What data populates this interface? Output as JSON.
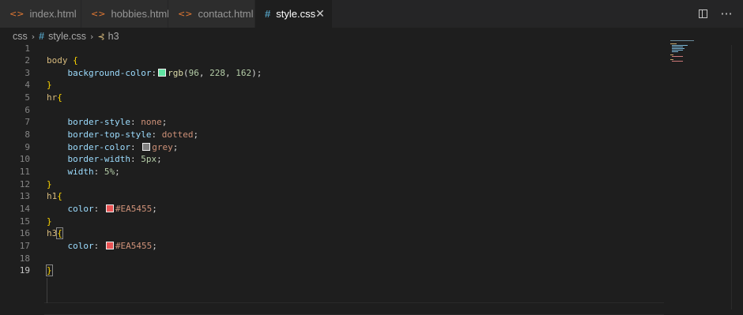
{
  "tabs": [
    {
      "label": "index.html",
      "icon": "html-icon",
      "active": false
    },
    {
      "label": "hobbies.html",
      "icon": "html-icon",
      "active": false
    },
    {
      "label": "contact.html",
      "icon": "html-icon",
      "active": false
    },
    {
      "label": "style.css",
      "icon": "css-hash-icon",
      "active": true
    }
  ],
  "tab_close_glyph": "✕",
  "breadcrumb": {
    "folder": "css",
    "file": "style.css",
    "symbol": "h3"
  },
  "editor": {
    "current_line": 19,
    "lines": [
      {
        "n": "1"
      },
      {
        "n": "2",
        "selector": "body ",
        "open": "{"
      },
      {
        "n": "3",
        "prop": "background-color",
        "fn": "rgb",
        "args": [
          "96",
          "228",
          "162"
        ],
        "swatch": "#60e4a2"
      },
      {
        "n": "4",
        "close": "}"
      },
      {
        "n": "5",
        "selector": "hr",
        "open": "{"
      },
      {
        "n": "6"
      },
      {
        "n": "7",
        "prop": "border-style",
        "value": "none"
      },
      {
        "n": "8",
        "prop": "border-top-style",
        "value": "dotted"
      },
      {
        "n": "9",
        "prop": "border-color",
        "value": "grey",
        "swatch": "#808080"
      },
      {
        "n": "10",
        "prop": "border-width",
        "value": "5px"
      },
      {
        "n": "11",
        "prop": "width",
        "value": "5%"
      },
      {
        "n": "12",
        "close": "}"
      },
      {
        "n": "13",
        "selector": "h1",
        "open": "{"
      },
      {
        "n": "14",
        "prop": "color",
        "value": "#EA5455",
        "swatch": "#EA5455"
      },
      {
        "n": "15",
        "close": "}"
      },
      {
        "n": "16",
        "selector": "h3",
        "open": "{"
      },
      {
        "n": "17",
        "prop": "color",
        "value": "#EA5455",
        "swatch": "#EA5455"
      },
      {
        "n": "18"
      },
      {
        "n": "19",
        "close": "}"
      }
    ]
  },
  "colors": {
    "editor_bg": "#1e1e1e",
    "selector": "#d7ba7d",
    "property": "#9cdcfe",
    "value": "#ce9178",
    "number": "#b5cea8",
    "brace": "#ffd700"
  }
}
